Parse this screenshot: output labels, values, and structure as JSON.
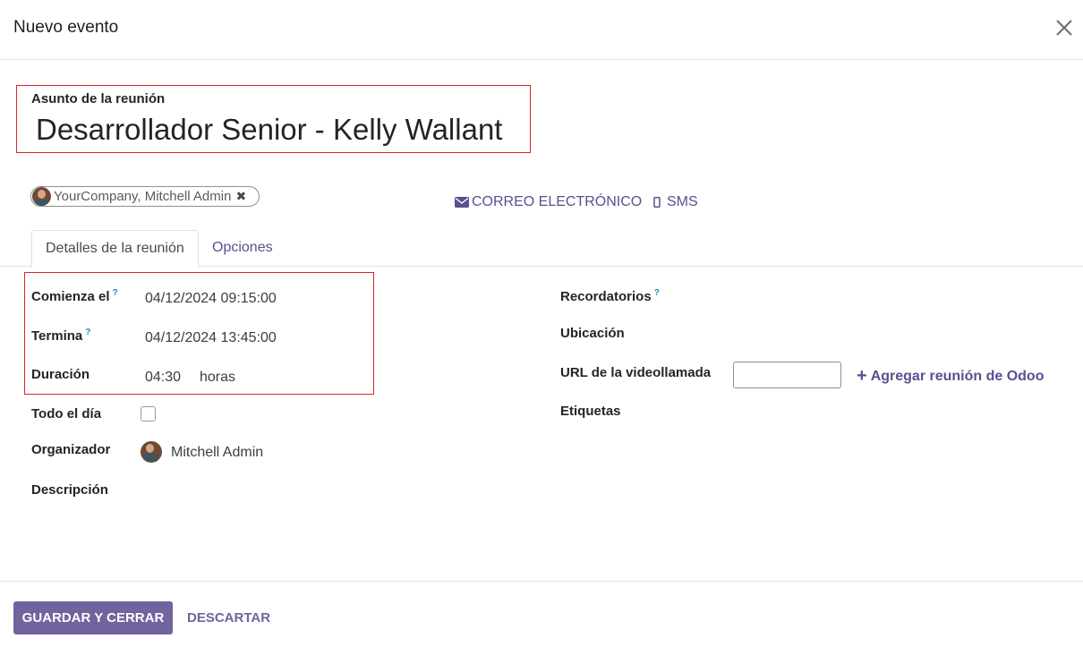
{
  "dialog": {
    "title": "Nuevo evento"
  },
  "subject": {
    "label": "Asunto de la reunión",
    "value": "Desarrollador Senior - Kelly Wallant"
  },
  "attendees": [
    {
      "name": "YourCompany, Mitchell Admin"
    }
  ],
  "actions": {
    "email_label": "CORREO ELECTRÓNICO",
    "sms_label": "SMS"
  },
  "tabs": [
    {
      "label": "Detalles de la reunión",
      "active": true
    },
    {
      "label": "Opciones",
      "active": false
    }
  ],
  "left_fields": {
    "start": {
      "label": "Comienza el",
      "help": "?",
      "value": "04/12/2024 09:15:00"
    },
    "stop": {
      "label": "Termina",
      "help": "?",
      "value": "04/12/2024 13:45:00"
    },
    "duration": {
      "label": "Duración",
      "value": "04:30",
      "unit": "horas"
    },
    "allday": {
      "label": "Todo el día",
      "checked": false
    },
    "organizer": {
      "label": "Organizador",
      "value": "Mitchell Admin"
    },
    "description": {
      "label": "Descripción"
    }
  },
  "right_fields": {
    "reminders": {
      "label": "Recordatorios",
      "help": "?"
    },
    "location": {
      "label": "Ubicación"
    },
    "video_url": {
      "label": "URL de la videollamada",
      "value": ""
    },
    "add_odoo_meeting": {
      "label": "Agregar reunión de Odoo"
    },
    "tags": {
      "label": "Etiquetas"
    }
  },
  "footer": {
    "save_label": "GUARDAR Y CERRAR",
    "discard_label": "DESCARTAR"
  },
  "colors": {
    "primary": "#71639e",
    "link": "#5a4f8f",
    "highlight_border": "#d9232e",
    "help": "#1a8fa8"
  }
}
